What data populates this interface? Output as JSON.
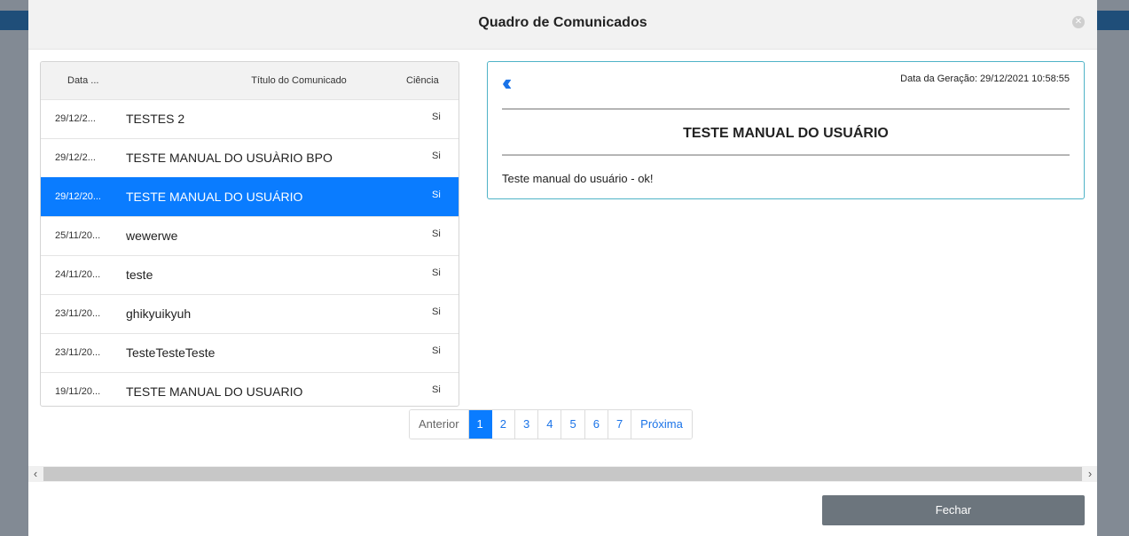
{
  "modal": {
    "title": "Quadro de Comunicados",
    "close_icon": "close-icon"
  },
  "table": {
    "headers": {
      "date": "Data ...",
      "title": "Título do Comunicado",
      "ciencia": "Ciência"
    },
    "rows": [
      {
        "date": "29/12/2...",
        "title": "TESTES 2",
        "ciencia": "Si",
        "selected": false
      },
      {
        "date": "29/12/2...",
        "title": "TESTE MANUAL DO USUÀRIO BPO",
        "ciencia": "Si",
        "selected": false
      },
      {
        "date": "29/12/20...",
        "title": "TESTE MANUAL DO USUÁRIO",
        "ciencia": "Si",
        "selected": true
      },
      {
        "date": "25/11/20...",
        "title": "wewerwe",
        "ciencia": "Si",
        "selected": false
      },
      {
        "date": "24/11/20...",
        "title": "teste",
        "ciencia": "Si",
        "selected": false
      },
      {
        "date": "23/11/20...",
        "title": "ghikyuikyuh",
        "ciencia": "Si",
        "selected": false
      },
      {
        "date": "23/11/20...",
        "title": "TesteTesteTeste",
        "ciencia": "Si",
        "selected": false
      },
      {
        "date": "19/11/20...",
        "title": "TESTE MANUAL DO USUARIO",
        "ciencia": "Si",
        "selected": false
      }
    ]
  },
  "detail": {
    "back_icon": "double-chevron-left-icon",
    "generation_date": "Data da Geração: 29/12/2021 10:58:55",
    "title": "TESTE MANUAL DO USUÁRIO",
    "body": "Teste manual do usuário - ok!"
  },
  "pagination": {
    "previous": "Anterior",
    "pages": [
      "1",
      "2",
      "3",
      "4",
      "5",
      "6",
      "7"
    ],
    "active_page": "1",
    "next": "Próxima"
  },
  "footer": {
    "close_button": "Fechar"
  },
  "colors": {
    "accent": "#0a7cff",
    "detail_border": "#4fb3c7",
    "button_bg": "#6c757d"
  }
}
